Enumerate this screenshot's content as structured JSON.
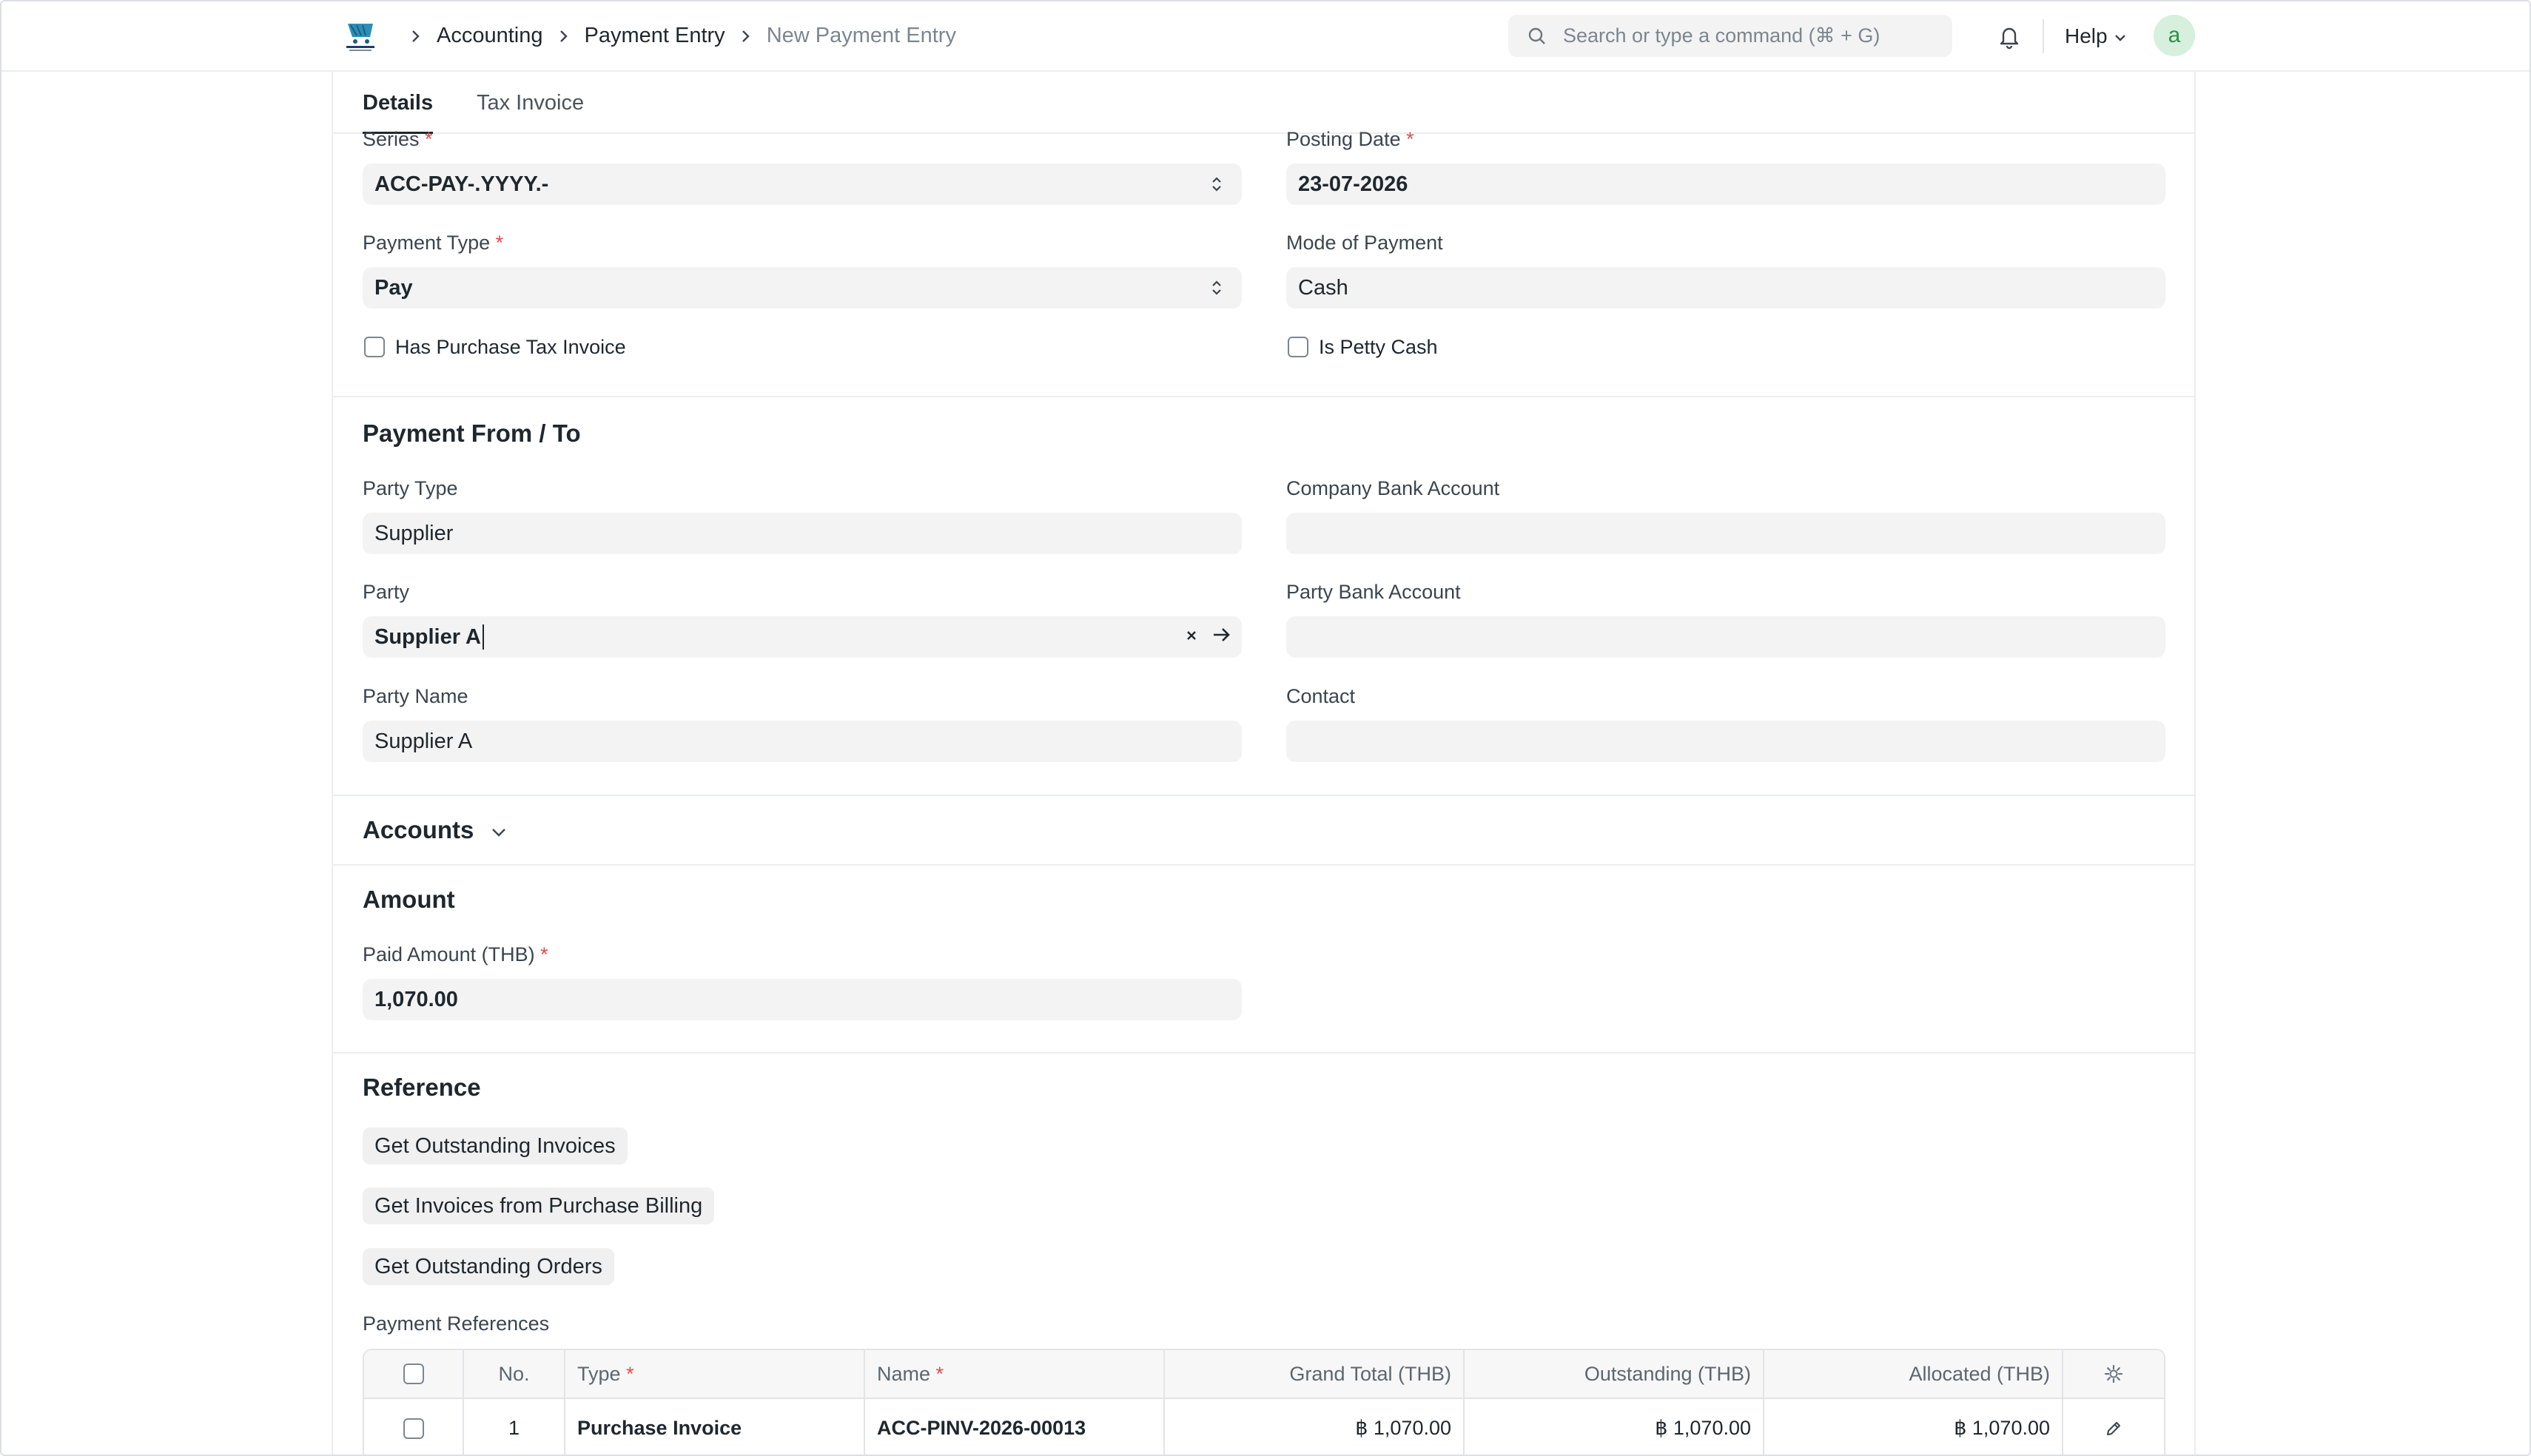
{
  "navbar": {
    "breadcrumbs": [
      "Accounting",
      "Payment Entry",
      "New Payment Entry"
    ],
    "search_placeholder": "Search or type a command (⌘ + G)",
    "help_label": "Help",
    "avatar_letter": "a"
  },
  "tabs": [
    "Details",
    "Tax Invoice"
  ],
  "details": {
    "series_label": "Series",
    "series_value": "ACC-PAY-.YYYY.-",
    "posting_date_label": "Posting Date",
    "posting_date_value": "23-07-2026",
    "payment_type_label": "Payment Type",
    "payment_type_value": "Pay",
    "mode_of_payment_label": "Mode of Payment",
    "mode_of_payment_value": "Cash",
    "has_purchase_tax_invoice_label": "Has Purchase Tax Invoice",
    "is_petty_cash_label": "Is Petty Cash"
  },
  "payment_from_to": {
    "title": "Payment From / To",
    "party_type_label": "Party Type",
    "party_type_value": "Supplier",
    "company_bank_account_label": "Company Bank Account",
    "company_bank_account_value": "",
    "party_label": "Party",
    "party_value": "Supplier A",
    "party_bank_account_label": "Party Bank Account",
    "party_bank_account_value": "",
    "party_name_label": "Party Name",
    "party_name_value": "Supplier A",
    "contact_label": "Contact",
    "contact_value": ""
  },
  "accounts": {
    "title": "Accounts"
  },
  "amount": {
    "title": "Amount",
    "paid_amount_label": "Paid Amount (THB)",
    "paid_amount_value": "1,070.00"
  },
  "reference": {
    "title": "Reference",
    "btn_outstanding_invoices": "Get Outstanding Invoices",
    "btn_invoices_purchase_billing": "Get Invoices from Purchase Billing",
    "btn_outstanding_orders": "Get Outstanding Orders",
    "payment_references_label": "Payment References",
    "columns": {
      "no": "No.",
      "type": "Type",
      "name": "Name",
      "grand_total": "Grand Total (THB)",
      "outstanding": "Outstanding (THB)",
      "allocated": "Allocated (THB)"
    },
    "rows": [
      {
        "no": "1",
        "type": "Purchase Invoice",
        "name": "ACC-PINV-2026-00013",
        "grand_total": "฿ 1,070.00",
        "outstanding": "฿ 1,070.00",
        "allocated": "฿ 1,070.00"
      }
    ]
  }
}
